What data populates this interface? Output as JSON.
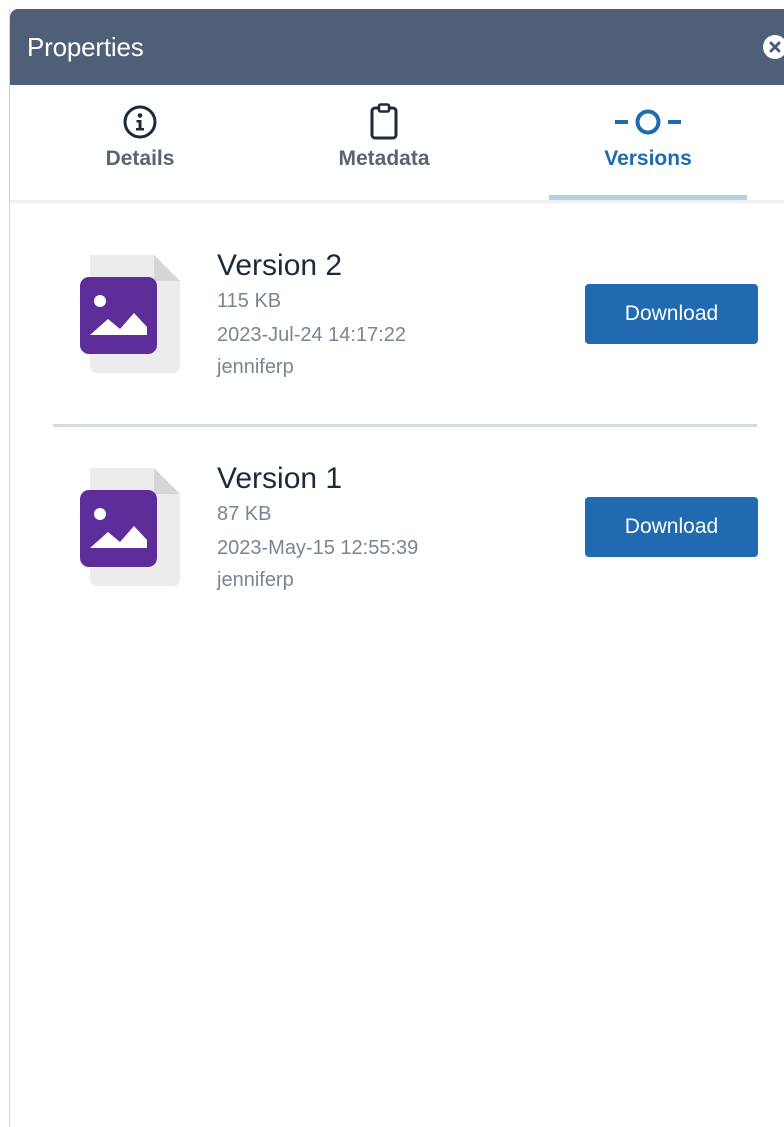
{
  "panel": {
    "title": "Properties"
  },
  "tabs": [
    {
      "label": "Details",
      "icon": "info-circle-icon",
      "active": false
    },
    {
      "label": "Metadata",
      "icon": "clipboard-icon",
      "active": false
    },
    {
      "label": "Versions",
      "icon": "version-history-icon",
      "active": true
    }
  ],
  "versions": [
    {
      "name": "Version 2",
      "size": "115 KB",
      "date": "2023-Jul-24 14:17:22",
      "user": "jenniferp",
      "button": "Download",
      "icon": "image-file-icon"
    },
    {
      "name": "Version 1",
      "size": "87 KB",
      "date": "2023-May-15 12:55:39",
      "user": "jenniferp",
      "button": "Download",
      "icon": "image-file-icon"
    }
  ],
  "colors": {
    "header": "#4f5f78",
    "accent": "#1e6bb0",
    "button": "#1f6ab0",
    "file_icon": "#5d2e9a"
  }
}
